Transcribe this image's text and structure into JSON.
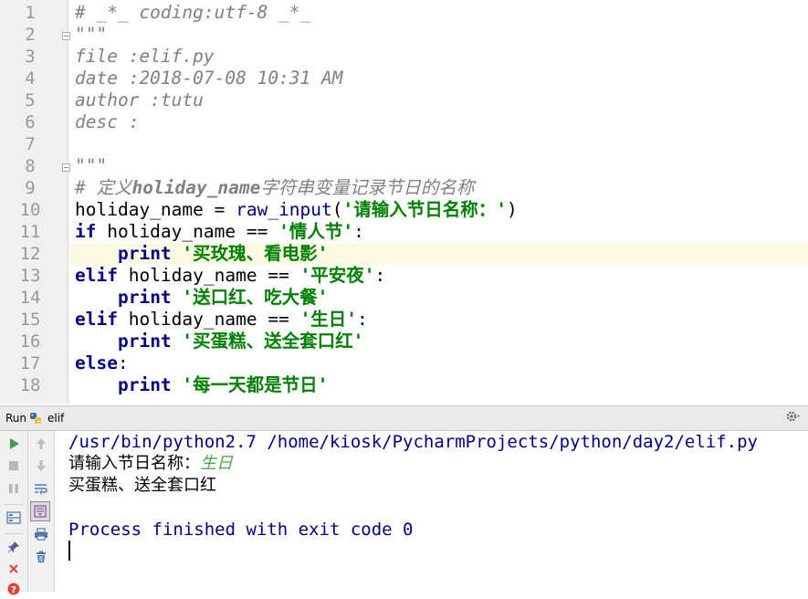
{
  "editor": {
    "line_numbers": [
      "1",
      "2",
      "3",
      "4",
      "5",
      "6",
      "7",
      "8",
      "9",
      "10",
      "11",
      "12",
      "13",
      "14",
      "15",
      "16",
      "17",
      "18"
    ],
    "lines": {
      "l1": "# _*_ coding:utf-8 _*_",
      "l2": "\"\"\"",
      "l3": "file :elif.py",
      "l4": "date :2018-07-08 10:31 AM",
      "l5": "author :tutu",
      "l6": "desc :",
      "l8": "\"\"\"",
      "l9_hash": "# ",
      "l9_cn1": "定义",
      "l9_var": "holiday_name",
      "l9_cn2": "字符串变量记录节日的名称",
      "l10_var": "holiday_name = ",
      "l10_fn": "raw_input",
      "l10_paren": "(",
      "l10_str": "'请输入节日名称：'",
      "l10_close": ")",
      "l11_kw": "if",
      "l11_mid": " holiday_name == ",
      "l11_str": "'情人节'",
      "l11_end": ":",
      "l12_indent": "    ",
      "l12_kw": "print",
      "l12_sp": " ",
      "l12_str": "'买玫瑰、看电影'",
      "l13_kw": "elif",
      "l13_mid": " holiday_name == ",
      "l13_str": "'平安夜'",
      "l13_end": ":",
      "l14_indent": "    ",
      "l14_kw": "print",
      "l14_sp": " ",
      "l14_str": "'送口红、吃大餐'",
      "l15_kw": "elif",
      "l15_mid": " holiday_name == ",
      "l15_str": "'生日'",
      "l15_end": ":",
      "l16_indent": "    ",
      "l16_kw": "print",
      "l16_sp": " ",
      "l16_str": "'买蛋糕、送全套口红'",
      "l17_kw": "else",
      "l17_end": ":",
      "l18_indent": "    ",
      "l18_kw": "print",
      "l18_sp": " ",
      "l18_str": "'每一天都是节日'"
    }
  },
  "run_panel": {
    "title": "Run",
    "config_name": "elif",
    "console": {
      "command": "/usr/bin/python2.7 /home/kiosk/PycharmProjects/python/day2/elif.py",
      "prompt": "请输入节日名称：",
      "user_input": "生日",
      "output": "买蛋糕、送全套口红",
      "exit_message": "Process finished with exit code 0"
    }
  },
  "colors": {
    "keyword": "#000080",
    "string": "#008000",
    "comment": "#808080",
    "current_line": "#fcfae4",
    "user_input": "#4fa84f"
  },
  "icons": {
    "run": "run-icon",
    "stop": "stop-icon",
    "pause": "pause-icon",
    "layout": "layout-icon",
    "pin": "pin-icon",
    "close": "close-icon",
    "help": "help-icon",
    "up": "up-arrow-icon",
    "down": "down-arrow-icon",
    "wrap": "soft-wrap-icon",
    "scroll_end": "scroll-to-end-icon",
    "print": "print-icon",
    "trash": "trash-icon",
    "settings": "gear-icon",
    "python_file": "python-file-icon"
  }
}
